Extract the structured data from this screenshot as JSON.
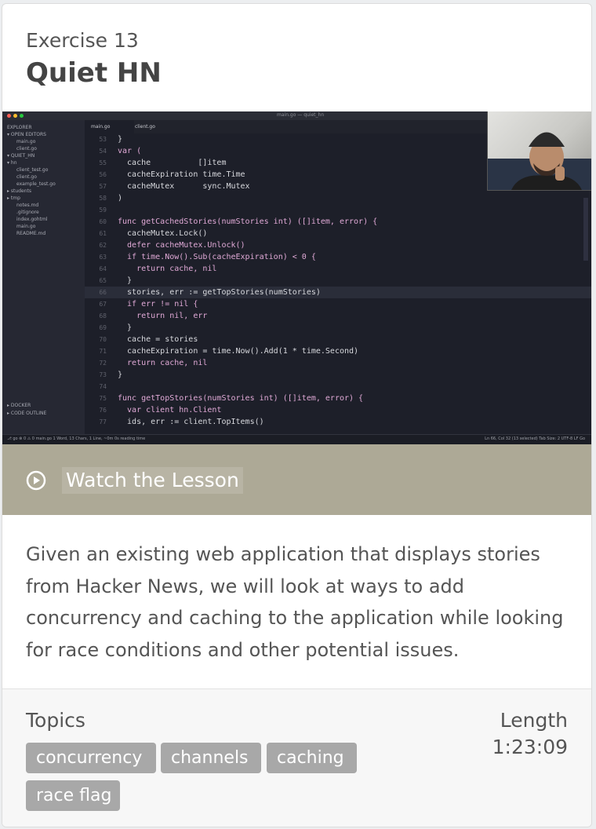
{
  "exercise": {
    "number_label": "Exercise 13",
    "title": "Quiet HN"
  },
  "video": {
    "window_title": "main.go — quiet_hn",
    "sidebar": [
      "EXPLORER",
      "▾ OPEN EDITORS",
      "main.go",
      "client.go",
      "▾ QUIET_HN",
      "▾ hn",
      "client_test.go",
      "client.go",
      "example_test.go",
      "▸ students",
      "▸ tmp",
      "notes.md",
      ".gitignore",
      "index.gohtml",
      "main.go",
      "README.md",
      "▸ DOCKER",
      "▸ CODE OUTLINE"
    ],
    "tabs": [
      "main.go",
      "client.go"
    ],
    "line_numbers": [
      "53",
      "54",
      "55",
      "56",
      "57",
      "58",
      "59",
      "60",
      "61",
      "62",
      "63",
      "64",
      "65",
      "66",
      "67",
      "68",
      "69",
      "70",
      "71",
      "72",
      "73",
      "74",
      "75",
      "76",
      "77"
    ],
    "code_lines": [
      "}",
      "var (",
      "  cache          []item",
      "  cacheExpiration time.Time",
      "  cacheMutex      sync.Mutex",
      ")",
      "",
      "func getCachedStories(numStories int) ([]item, error) {",
      "  cacheMutex.Lock()",
      "  defer cacheMutex.Unlock()",
      "  if time.Now().Sub(cacheExpiration) < 0 {",
      "    return cache, nil",
      "  }",
      "  stories, err := getTopStories(numStories)",
      "  if err != nil {",
      "    return nil, err",
      "  }",
      "  cache = stories",
      "  cacheExpiration = time.Now().Add(1 * time.Second)",
      "  return cache, nil",
      "}",
      "",
      "func getTopStories(numStories int) ([]item, error) {",
      "  var client hn.Client",
      "  ids, err := client.TopItems()"
    ],
    "status_left": "⎇ go ⊗ 0 ⚠ 0  main.go  1 Word, 13 Chars, 1 Line, ~0m 0s reading time",
    "status_right": "Ln 66, Col 32 (13 selected)  Tab Size: 2  UTF-8  LF  Go"
  },
  "watch": {
    "label": "Watch the Lesson",
    "icon": "play-circle-icon"
  },
  "description": "Given an existing web application that displays stories from Hacker News, we will look at ways to add concurrency and caching to the application while looking for race conditions and other potential issues.",
  "footer": {
    "topics_label": "Topics",
    "topics": [
      "concurrency",
      "channels",
      "caching",
      "race flag"
    ],
    "length_label": "Length",
    "length_value": "1:23:09"
  },
  "colors": {
    "watch_bg": "#ada996",
    "tag_bg": "#a8a8a8",
    "editor_bg": "#1d1f29"
  }
}
